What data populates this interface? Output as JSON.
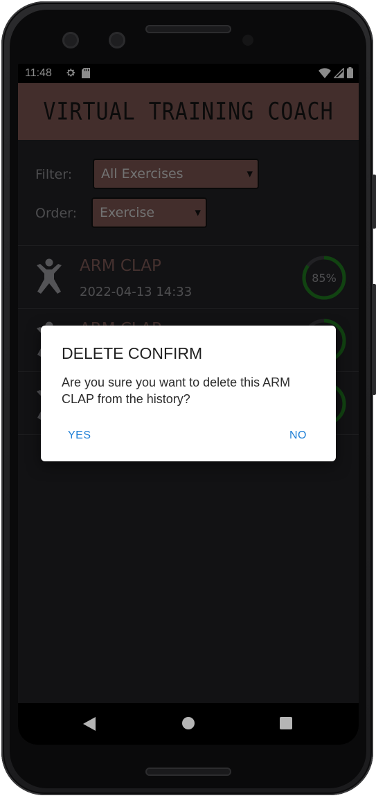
{
  "status_bar": {
    "time": "11:48",
    "left_icons": [
      "gear-icon",
      "sd-card-icon"
    ],
    "right_icons": [
      "wifi-icon",
      "signal-icon",
      "battery-icon"
    ]
  },
  "app": {
    "title": "VIRTUAL TRAINING COACH",
    "header_color": "#7a5450",
    "background_color": "#222226"
  },
  "filters": {
    "filter_label": "Filter:",
    "filter_value": "All Exercises",
    "order_label": "Order:",
    "order_value": "Exercise"
  },
  "history": {
    "items": [
      {
        "name": "ARM CLAP",
        "date": "2022-04-13 14:33",
        "score": "85%",
        "score_fraction": 0.85
      },
      {
        "name": "ARM CLAP",
        "date": "",
        "score": "",
        "score_fraction": 0.85
      },
      {
        "name": "",
        "date": "",
        "score": "",
        "score_fraction": 0.85
      }
    ]
  },
  "dialog": {
    "title": "DELETE CONFIRM",
    "message": "Are you sure you want to delete this ARM CLAP from the history?",
    "yes_label": "YES",
    "no_label": "NO",
    "accent_color": "#1e7fd6"
  },
  "nav_bar": {
    "icons": [
      "back-icon",
      "home-icon",
      "recents-icon"
    ]
  }
}
